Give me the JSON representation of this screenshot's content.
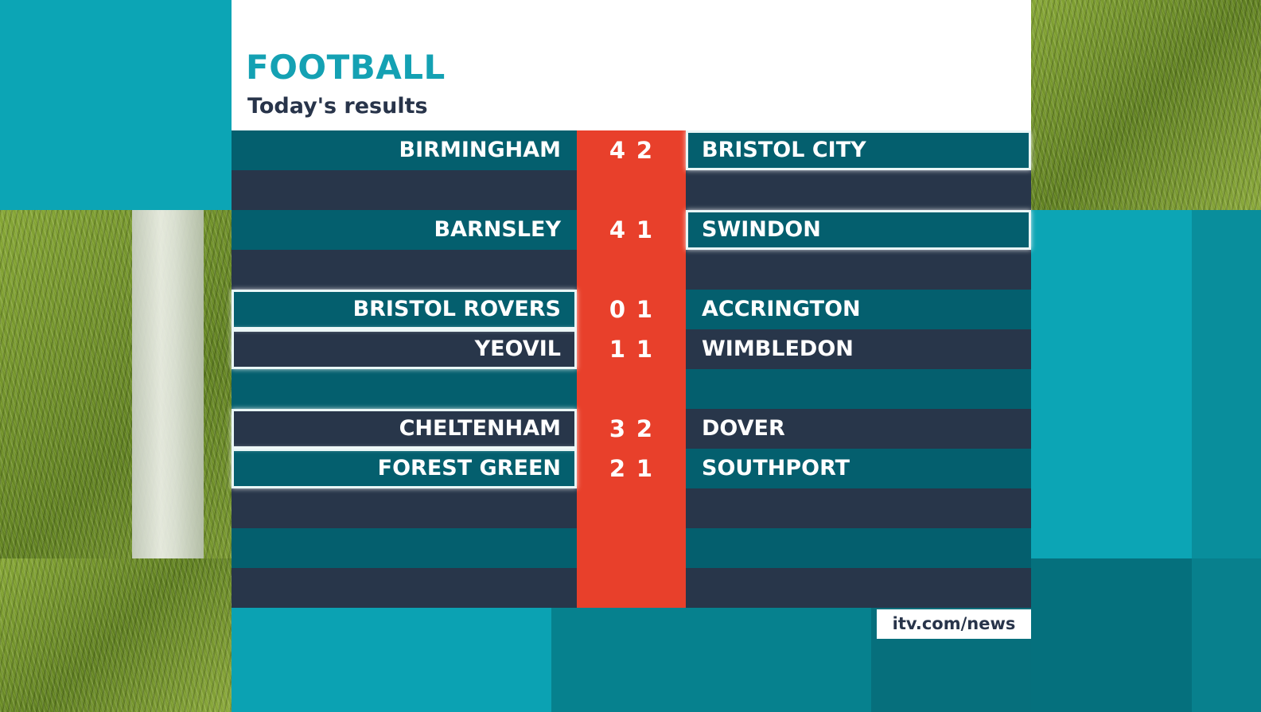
{
  "header": {
    "title": "FOOTBALL",
    "subtitle": "Today's results"
  },
  "colors": {
    "title": "#14a1b3",
    "stripe_teal": "#045f6e",
    "stripe_navy": "#28364a",
    "score_column": "#e8402b",
    "highlight_border": "#e9f6f6"
  },
  "rows": [
    {
      "home": "BIRMINGHAM",
      "home_score": "4",
      "away_score": "2",
      "away": "BRISTOL CITY",
      "highlight": "away"
    },
    {
      "home": "",
      "home_score": "",
      "away_score": "",
      "away": "",
      "highlight": ""
    },
    {
      "home": "BARNSLEY",
      "home_score": "4",
      "away_score": "1",
      "away": "SWINDON",
      "highlight": "away"
    },
    {
      "home": "",
      "home_score": "",
      "away_score": "",
      "away": "",
      "highlight": ""
    },
    {
      "home": "BRISTOL ROVERS",
      "home_score": "0",
      "away_score": "1",
      "away": "ACCRINGTON",
      "highlight": "home"
    },
    {
      "home": "YEOVIL",
      "home_score": "1",
      "away_score": "1",
      "away": "WIMBLEDON",
      "highlight": "home"
    },
    {
      "home": "",
      "home_score": "",
      "away_score": "",
      "away": "",
      "highlight": ""
    },
    {
      "home": "CHELTENHAM",
      "home_score": "3",
      "away_score": "2",
      "away": "DOVER",
      "highlight": "home"
    },
    {
      "home": "FOREST GREEN",
      "home_score": "2",
      "away_score": "1",
      "away": "SOUTHPORT",
      "highlight": "home"
    },
    {
      "home": "",
      "home_score": "",
      "away_score": "",
      "away": "",
      "highlight": ""
    },
    {
      "home": "",
      "home_score": "",
      "away_score": "",
      "away": "",
      "highlight": ""
    },
    {
      "home": "",
      "home_score": "",
      "away_score": "",
      "away": "",
      "highlight": ""
    }
  ],
  "footer": {
    "url": "itv.com/news"
  }
}
